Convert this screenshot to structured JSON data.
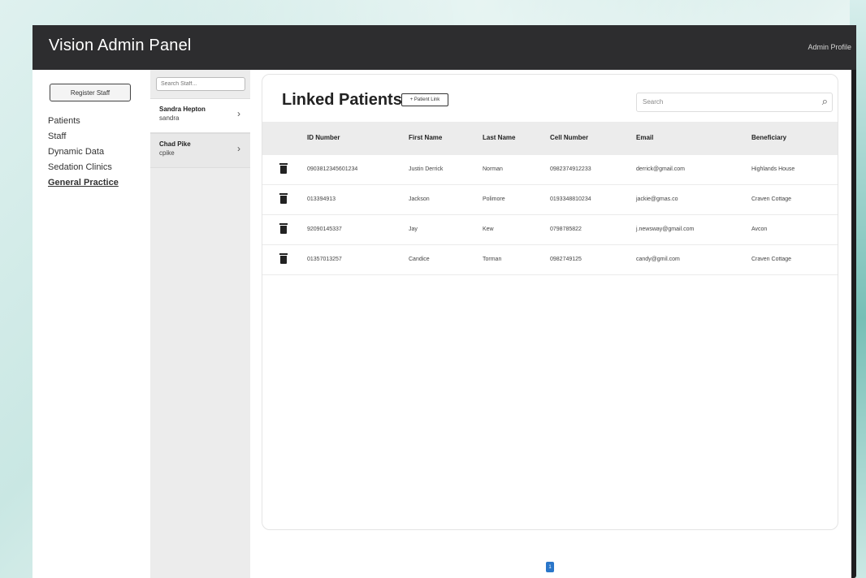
{
  "app": {
    "title": "Vision Admin Panel",
    "profile_label": "Admin Profile"
  },
  "nav": {
    "register_label": "Register Staff",
    "items": [
      {
        "label": "Patients",
        "active": false
      },
      {
        "label": "Staff",
        "active": false
      },
      {
        "label": "Dynamic Data",
        "active": false
      },
      {
        "label": "Sedation Clinics",
        "active": false
      },
      {
        "label": "General Practice",
        "active": true
      }
    ]
  },
  "staff": {
    "search_placeholder": "Search Staff...",
    "items": [
      {
        "name": "Sandra Hepton",
        "username": "sandra"
      },
      {
        "name": "Chad Pike",
        "username": "cpike"
      }
    ]
  },
  "main": {
    "title": "Linked Patients",
    "add_button": "+ Patient Link",
    "search_placeholder": "Search",
    "columns": [
      "ID Number",
      "First Name",
      "Last Name",
      "Cell Number",
      "Email",
      "Beneficiary"
    ],
    "rows": [
      [
        "0903812345601234",
        "Justin Derrick",
        "Norman",
        "0982374912233",
        "derrick@gmail.com",
        "Highlands House"
      ],
      [
        "013394913",
        "Jackson",
        "Polimore",
        "0193348810234",
        "jackie@gmas.co",
        "Craven Cottage"
      ],
      [
        "92090145337",
        "Jay",
        "Kew",
        "0798785822",
        "j.newsway@gmail.com",
        "Avcon"
      ],
      [
        "01357013257",
        "Candice",
        "Torman",
        "0982749125",
        "candy@gmil.com",
        "Craven Cottage"
      ]
    ],
    "page": "1"
  }
}
